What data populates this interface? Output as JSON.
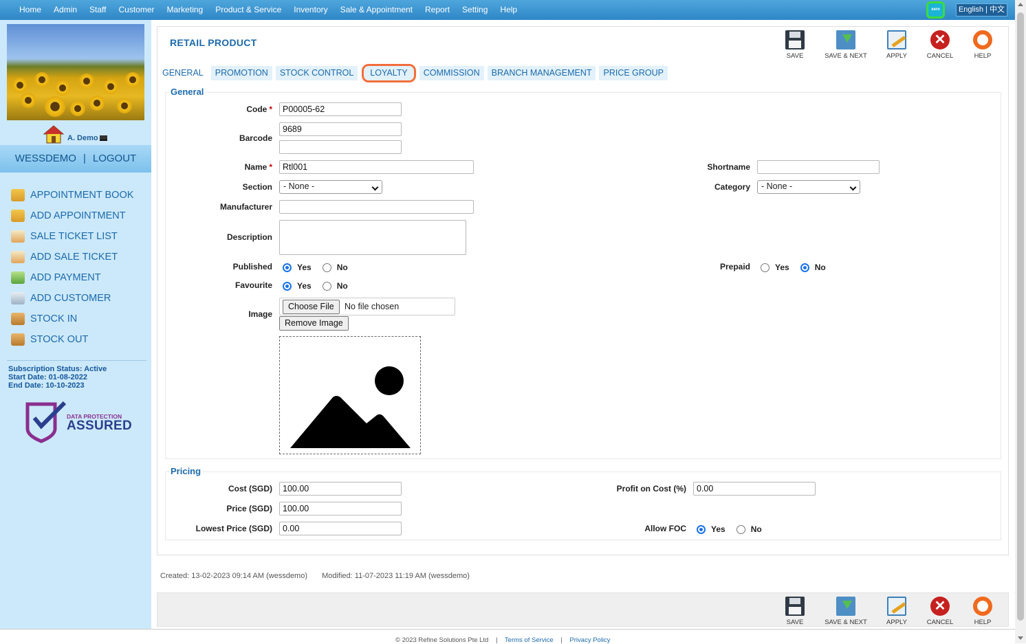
{
  "topnav": [
    "Home",
    "Admin",
    "Staff",
    "Customer",
    "Marketing",
    "Product & Service",
    "Inventory",
    "Sale & Appointment",
    "Report",
    "Setting",
    "Help"
  ],
  "xero_label": "xero",
  "language": "English | 中文",
  "sidebar": {
    "user": "A. Demo",
    "account": "WESSDEMO",
    "logout": "LOGOUT",
    "menu": [
      "APPOINTMENT BOOK",
      "ADD APPOINTMENT",
      "SALE TICKET LIST",
      "ADD SALE TICKET",
      "ADD PAYMENT",
      "ADD CUSTOMER",
      "STOCK IN",
      "STOCK OUT"
    ],
    "subscription_status": "Subscription Status: Active",
    "start_date": "Start Date: 01-08-2022",
    "end_date": "End Date: 10-10-2023",
    "dpa_top": "DATA PROTECTION",
    "dpa_main": "ASSURED"
  },
  "page": {
    "title": "RETAIL PRODUCT"
  },
  "toolbar": {
    "save": "SAVE",
    "save_next": "SAVE & NEXT",
    "apply": "APPLY",
    "cancel": "CANCEL",
    "help": "HELP"
  },
  "tabs": [
    "GENERAL",
    "PROMOTION",
    "STOCK CONTROL",
    "LOYALTY",
    "COMMISSION",
    "BRANCH MANAGEMENT",
    "PRICE GROUP"
  ],
  "general": {
    "legend": "General",
    "code_label": "Code",
    "code": "P00005-62",
    "barcode_label": "Barcode",
    "barcode1": "9689",
    "barcode2": "",
    "name_label": "Name",
    "name": "Rtl001",
    "shortname_label": "Shortname",
    "shortname": "",
    "section_label": "Section",
    "section": "- None -",
    "category_label": "Category",
    "category": "- None -",
    "manufacturer_label": "Manufacturer",
    "manufacturer": "",
    "description_label": "Description",
    "description": "",
    "published_label": "Published",
    "prepaid_label": "Prepaid",
    "favourite_label": "Favourite",
    "yes": "Yes",
    "no": "No",
    "image_label": "Image",
    "choose_file": "Choose File",
    "no_file": "No file chosen",
    "remove_image": "Remove Image"
  },
  "pricing": {
    "legend": "Pricing",
    "cost_label": "Cost (SGD)",
    "cost": "100.00",
    "price_label": "Price (SGD)",
    "price": "100.00",
    "lowest_label": "Lowest Price (SGD)",
    "lowest": "0.00",
    "profit_label": "Profit on Cost (%)",
    "profit": "0.00",
    "foc_label": "Allow FOC"
  },
  "meta": {
    "created": "Created: 13-02-2023 09:14 AM (wessdemo)",
    "modified": "Modified: 11-07-2023 11:19 AM (wessdemo)"
  },
  "footer": {
    "copyright": "© 2023 Refine Solutions Pte Ltd",
    "sep": "|",
    "terms": "Terms of Service",
    "privacy": "Privacy Policy"
  },
  "colors": {
    "accent": "#1c6aab",
    "topbar": "#2f86c6",
    "sidebar": "#cce9fb",
    "highlight": "#f26d3b"
  }
}
